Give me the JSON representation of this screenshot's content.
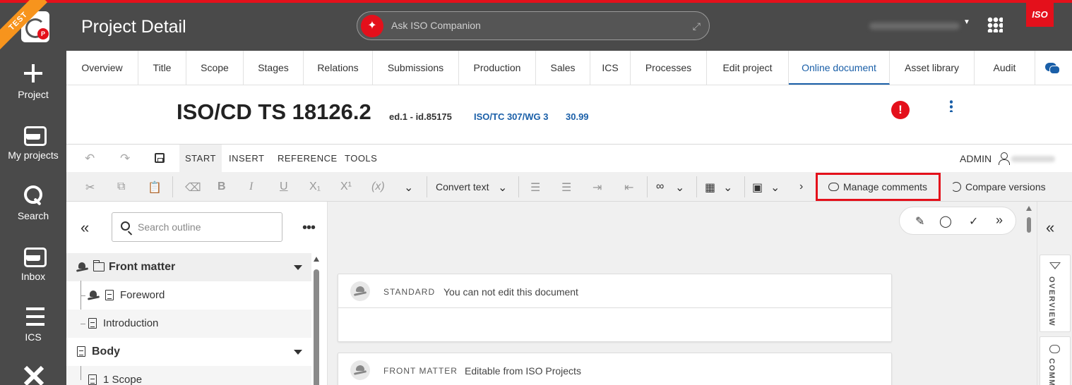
{
  "nav": {
    "ribbon": "TEST",
    "logo_badge": "P",
    "items": [
      {
        "label": "Project",
        "icon": "plus-icon"
      },
      {
        "label": "My projects",
        "icon": "tray-icon"
      },
      {
        "label": "Search",
        "icon": "search-icon"
      },
      {
        "label": "Inbox",
        "icon": "tray-icon"
      },
      {
        "label": "ICS",
        "icon": "list-icon"
      },
      {
        "label": "",
        "icon": "tools-icon"
      }
    ]
  },
  "header": {
    "title": "Project Detail",
    "companion_placeholder": "Ask ISO Companion",
    "iso_badge": "ISO"
  },
  "tabs": [
    {
      "label": "Overview"
    },
    {
      "label": "Title"
    },
    {
      "label": "Scope"
    },
    {
      "label": "Stages"
    },
    {
      "label": "Relations"
    },
    {
      "label": "Submissions"
    },
    {
      "label": "Production"
    },
    {
      "label": "Sales"
    },
    {
      "label": "ICS"
    },
    {
      "label": "Processes"
    },
    {
      "label": "Edit project"
    },
    {
      "label": "Online document",
      "active": true
    },
    {
      "label": "Asset library"
    },
    {
      "label": "Audit"
    }
  ],
  "document": {
    "title": "ISO/CD TS 18126.2",
    "edition": "ed.1 - id.85175",
    "committee": "ISO/TC 307/WG 3",
    "stage": "30.99",
    "alert": "!"
  },
  "ribbon": {
    "tabs": [
      {
        "label": "START",
        "active": true
      },
      {
        "label": "INSERT"
      },
      {
        "label": "REFERENCE"
      },
      {
        "label": "TOOLS"
      }
    ],
    "user_role": "ADMIN"
  },
  "toolbar": {
    "convert_text": "Convert text",
    "manage_comments": "Manage comments",
    "compare_versions": "Compare versions"
  },
  "outline": {
    "search_placeholder": "Search outline",
    "sections": [
      {
        "label": "Front matter",
        "children": [
          "Foreword",
          "Introduction"
        ]
      },
      {
        "label": "Body",
        "children": [
          "1 Scope"
        ]
      }
    ]
  },
  "cards": [
    {
      "kind": "STANDARD",
      "description": "You can not edit this document"
    },
    {
      "kind": "FRONT MATTER",
      "description": "Editable from ISO Projects"
    }
  ],
  "side_panel": {
    "overview_label": "OVERVIEW",
    "comments_label": "COMM"
  },
  "colors": {
    "accent": "#1a5fa8",
    "brand_red": "#e4101b",
    "header_bg": "#4a4a4a"
  }
}
